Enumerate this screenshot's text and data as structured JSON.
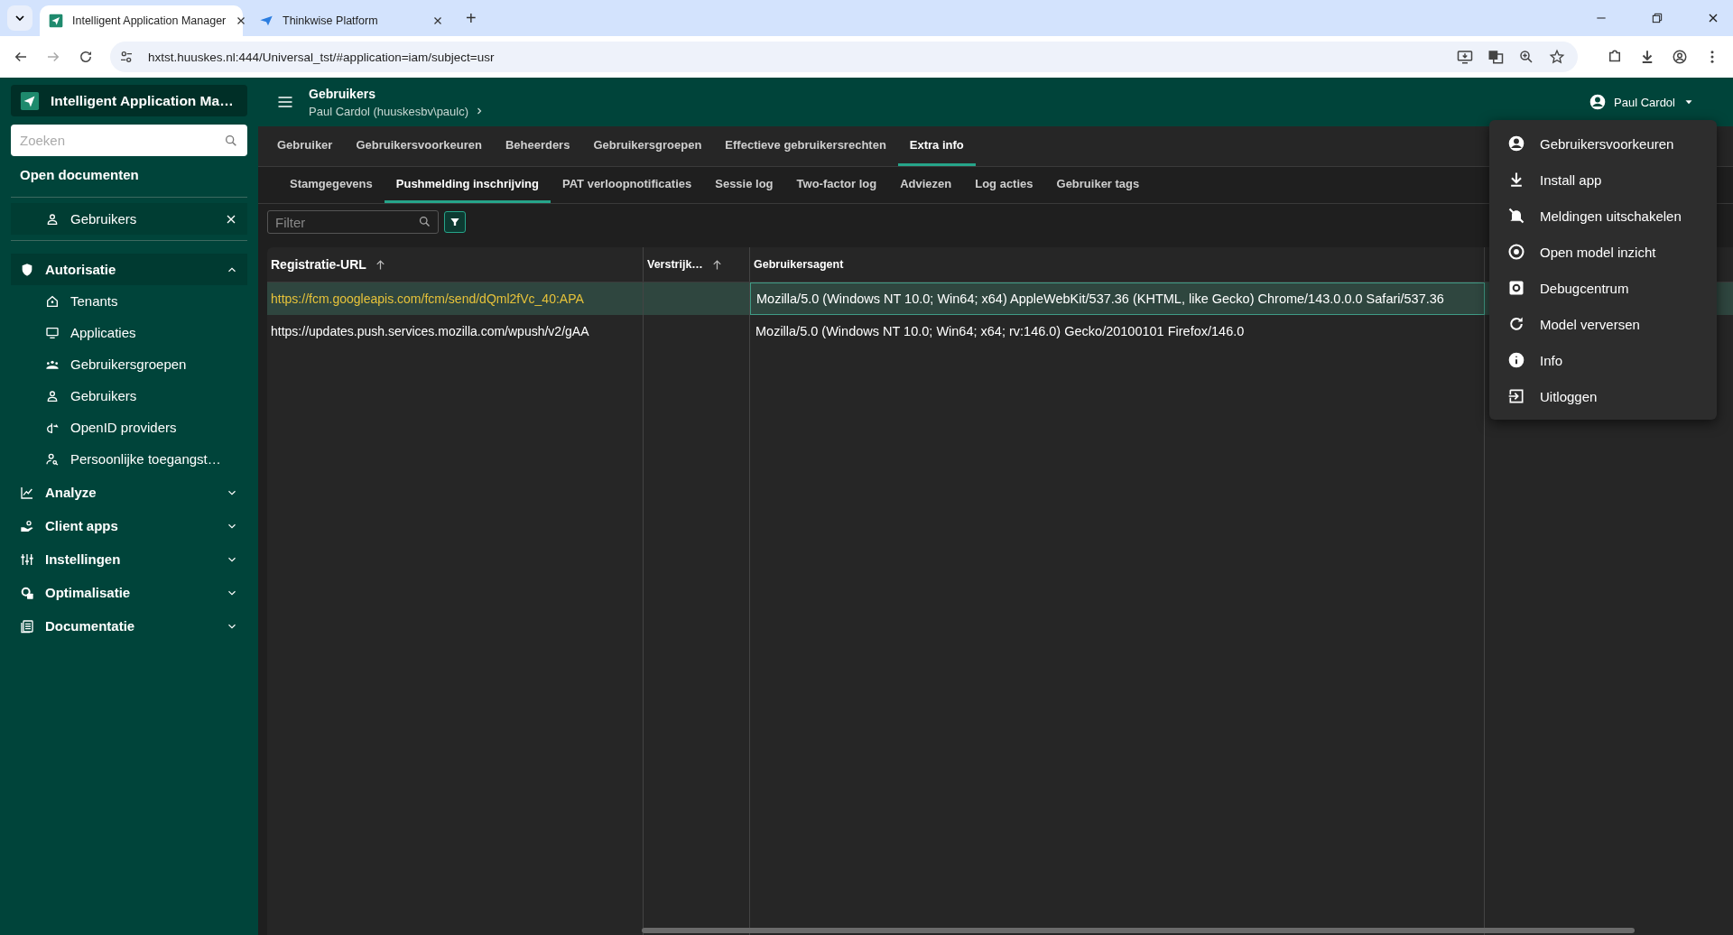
{
  "browser": {
    "tabs": [
      {
        "title": "Intelligent Application Manager",
        "selected": true
      },
      {
        "title": "Thinkwise Platform",
        "selected": false
      }
    ],
    "new_tab": "+",
    "url": "hxtst.huuskes.nl:444/Universal_tst/#application=iam/subject=usr"
  },
  "sidebar": {
    "app_title": "Intelligent Application Ma…",
    "search": {
      "placeholder": "Zoeken"
    },
    "open_documents_title": "Open documenten",
    "open_documents": [
      {
        "label": "Gebruikers"
      }
    ],
    "groups": [
      {
        "label": "Autorisatie",
        "expanded": true,
        "children": [
          {
            "label": "Tenants"
          },
          {
            "label": "Applicaties"
          },
          {
            "label": "Gebruikersgroepen"
          },
          {
            "label": "Gebruikers"
          },
          {
            "label": "OpenID providers"
          },
          {
            "label": "Persoonlijke toegangst…"
          }
        ]
      },
      {
        "label": "Analyze",
        "expanded": false
      },
      {
        "label": "Client apps",
        "expanded": false
      },
      {
        "label": "Instellingen",
        "expanded": false
      },
      {
        "label": "Optimalisatie",
        "expanded": false
      },
      {
        "label": "Documentatie",
        "expanded": false
      }
    ]
  },
  "header": {
    "title": "Gebruikers",
    "subtitle": "Paul Cardol (huuskesbv\\paulc)",
    "user": "Paul Cardol"
  },
  "tabs": [
    {
      "label": "Gebruiker",
      "selected": false
    },
    {
      "label": "Gebruikersvoorkeuren",
      "selected": false
    },
    {
      "label": "Beheerders",
      "selected": false
    },
    {
      "label": "Gebruikersgroepen",
      "selected": false
    },
    {
      "label": "Effectieve gebruikersrechten",
      "selected": false
    },
    {
      "label": "Extra info",
      "selected": true
    }
  ],
  "subtabs": [
    {
      "label": "Stamgegevens",
      "selected": false
    },
    {
      "label": "Pushmelding inschrijving",
      "selected": true
    },
    {
      "label": "PAT verloopnotificaties",
      "selected": false
    },
    {
      "label": "Sessie log",
      "selected": false
    },
    {
      "label": "Two-factor log",
      "selected": false
    },
    {
      "label": "Adviezen",
      "selected": false
    },
    {
      "label": "Log acties",
      "selected": false
    },
    {
      "label": "Gebruiker tags",
      "selected": false
    }
  ],
  "filter": {
    "placeholder": "Filter"
  },
  "table": {
    "columns": [
      {
        "label": "Registratie-URL",
        "sorted": true
      },
      {
        "label": "Verstrijk…",
        "sorted": true
      },
      {
        "label": "Gebruikersagent",
        "sorted": false
      }
    ],
    "rows": [
      {
        "selected": true,
        "cells": [
          "https://fcm.googleapis.com/fcm/send/dQml2fVc_40:APA",
          "",
          "Mozilla/5.0 (Windows NT 10.0; Win64; x64) AppleWebKit/537.36 (KHTML, like Gecko) Chrome/143.0.0.0 Safari/537.36"
        ]
      },
      {
        "selected": false,
        "cells": [
          "https://updates.push.services.mozilla.com/wpush/v2/gAA",
          "",
          "Mozilla/5.0 (Windows NT 10.0; Win64; x64; rv:146.0) Gecko/20100101 Firefox/146.0"
        ]
      }
    ]
  },
  "user_menu": [
    {
      "label": "Gebruikersvoorkeuren"
    },
    {
      "label": "Install app"
    },
    {
      "label": "Meldingen uitschakelen"
    },
    {
      "label": "Open model inzicht"
    },
    {
      "label": "Debugcentrum"
    },
    {
      "label": "Model verversen"
    },
    {
      "label": "Info"
    },
    {
      "label": "Uitloggen"
    }
  ]
}
